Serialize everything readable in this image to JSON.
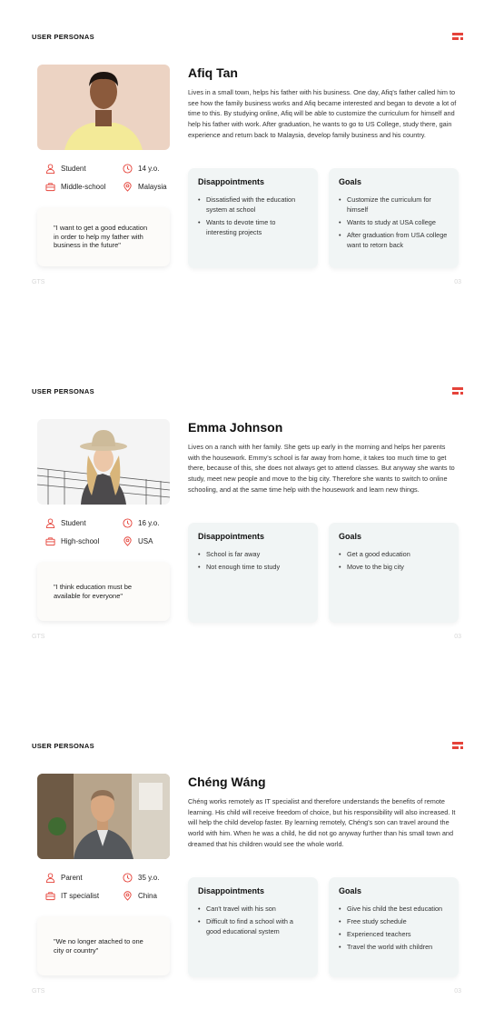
{
  "brand_color": "#e5433a",
  "slides": [
    {
      "header": "USER PERSONAS",
      "name": "Afiq Tan",
      "bio": "Lives in a small town, helps his father with his business. One day, Afiq's father called him to see how the family business works and Afiq became interested and began to devote a lot of time to this. By studying online, Afiq will be able to customize the curriculum for himself and help his father with work. After graduation, he wants to go to US College, study there, gain experience and return back to Malaysia, develop family business and his country.",
      "role": "Student",
      "age": "14 y.o.",
      "education": "Middle-school",
      "location": "Malaysia",
      "quote": "\"I want to get a good education in order to help my father with business in the future\"",
      "disappointments_title": "Disappointments",
      "disappointments": [
        "Dissatisfied with the education system at school",
        "Wants to devote time to interesting projects"
      ],
      "goals_title": "Goals",
      "goals": [
        "Customize the curriculum for himself",
        "Wants to study at USA college",
        "After graduation from USA college want to retorn back"
      ],
      "footer_left": "GTS",
      "footer_right": "03"
    },
    {
      "header": "USER PERSONAS",
      "name": "Emma Johnson",
      "bio": "Lives on a ranch with her family. She gets up early in the morning and helps her parents with the housework. Emmy's school is far away from home, it takes too much time to get there, because of this, she does not always get to attend classes. But anyway she wants to study, meet new people and move to the big city. Therefore she wants to switch to online schooling, and at the same time help with the housework and learn new things.",
      "role": "Student",
      "age": "16 y.o.",
      "education": "High-school",
      "location": "USA",
      "quote": "\"I think education must be available for everyone\"",
      "disappointments_title": "Disappointments",
      "disappointments": [
        "School is far away",
        "Not enough time to study"
      ],
      "goals_title": "Goals",
      "goals": [
        "Get a good education",
        "Move to the big city"
      ],
      "footer_left": "GTS",
      "footer_right": "03"
    },
    {
      "header": "USER PERSONAS",
      "name": "Chéng Wáng",
      "bio": "Chéng works remotely as IT specialist and therefore understands the benefits of remote learning. His child will receive freedom of choice, but his responsibility will also increased. It will help the child develop faster. By learning remotely, Chéng's son can travel around the world with him. When he was a child, he did not go anyway further than his small town and dreamed that his children would see the whole world.",
      "role": "Parent",
      "age": "35 y.o.",
      "education": "IT specialist",
      "location": "China",
      "quote": "\"We no longer atached to one city or country\"",
      "disappointments_title": "Disappointments",
      "disappointments": [
        "Can't travel with his son",
        "Difficult to find a school with a good educational system"
      ],
      "goals_title": "Goals",
      "goals": [
        "Give his child the best education",
        "Free study schedule",
        "Experienced teachers",
        "Travel the world with children"
      ],
      "footer_left": "GTS",
      "footer_right": "03"
    }
  ]
}
